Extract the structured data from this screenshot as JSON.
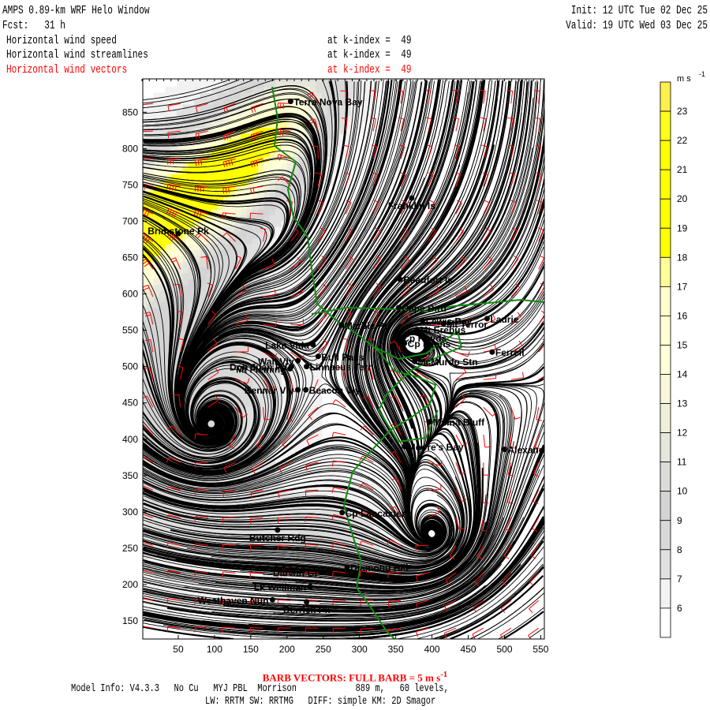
{
  "header": {
    "title": "AMPS 0.89-km WRF Helo Window",
    "forecast": "Fcst:   31 h",
    "init": "Init: 12 UTC Tue 02 Dec 25",
    "valid": "Valid: 19 UTC Wed 03 Dec 25",
    "fields": [
      {
        "name": "Horizontal wind speed",
        "level": "at k-index =  49",
        "color": "#000000"
      },
      {
        "name": "Horizontal wind streamlines",
        "level": "at k-index =  49",
        "color": "#000000"
      },
      {
        "name": "Horizontal wind vectors",
        "level": "at k-index =  49",
        "color": "#ff0000"
      }
    ]
  },
  "axes": {
    "x_ticks": [
      "50",
      "100",
      "150",
      "200",
      "250",
      "300",
      "350",
      "400",
      "450",
      "500",
      "550"
    ],
    "y_ticks": [
      "150",
      "200",
      "250",
      "300",
      "350",
      "400",
      "450",
      "500",
      "550",
      "600",
      "650",
      "700",
      "750",
      "800",
      "850"
    ],
    "xlim": [
      0,
      555
    ],
    "ylim": [
      125,
      895
    ]
  },
  "colorbar": {
    "units": "m s",
    "units_exp": "-1",
    "labels": [
      "23",
      "22",
      "21",
      "20",
      "19",
      "18",
      "17",
      "16",
      "15",
      "14",
      "13",
      "12",
      "11",
      "10",
      "9",
      "8",
      "7",
      "6"
    ],
    "colors": [
      "#fff04a",
      "#ffff1a",
      "#ffff00",
      "#ffff00",
      "#ffff00",
      "#ffff00",
      "#ffff99",
      "#ffffcc",
      "#ffffd6",
      "#ffffd9",
      "#f8f8d8",
      "#f0f0da",
      "#e6e6dc",
      "#dcdcd8",
      "#d4d4d4",
      "#d8d8d8",
      "#e0e0e0",
      "#f2f2f2",
      "#ffffff"
    ]
  },
  "map": {
    "streamline_color": "#000000",
    "barb_color": "#ff0000",
    "coast_color": "#138a13",
    "places": [
      {
        "name": "Terra Nova Bay",
        "x": 205,
        "y": 865
      },
      {
        "name": "Franklin Is",
        "x": 372,
        "y": 732
      },
      {
        "name": "Brimstone Pk",
        "x": 50,
        "y": 683
      },
      {
        "name": "Beaufort Is",
        "x": 356,
        "y": 620
      },
      {
        "name": "Cape Bird",
        "x": 354,
        "y": 581
      },
      {
        "name": "Marble Pt",
        "x": 275,
        "y": 557
      },
      {
        "name": "Lewis Bay",
        "x": 387,
        "y": 563
      },
      {
        "name": "Mt Terror",
        "x": 416,
        "y": 559
      },
      {
        "name": "Laurie",
        "x": 476,
        "y": 566
      },
      {
        "name": "Mt Erebus",
        "x": 379,
        "y": 551
      },
      {
        "name": "Cp Royds",
        "x": 355,
        "y": 540
      },
      {
        "name": "Cp Evans",
        "x": 362,
        "y": 532
      },
      {
        "name": "Ferrell",
        "x": 483,
        "y": 520
      },
      {
        "name": "McMurdo Stn",
        "x": 376,
        "y": 507
      },
      {
        "name": "Lake Vida",
        "x": 236,
        "y": 530
      },
      {
        "name": "Bull Pass",
        "x": 243,
        "y": 514
      },
      {
        "name": "Wall Vly",
        "x": 215,
        "y": 508
      },
      {
        "name": "Don Juan Pd",
        "x": 206,
        "y": 500
      },
      {
        "name": "Linnaeus Terr",
        "x": 227,
        "y": 500
      },
      {
        "name": "Mt Fleming",
        "x": 204,
        "y": 497
      },
      {
        "name": "Kennar Vly",
        "x": 215,
        "y": 468
      },
      {
        "name": "Beacon Vly",
        "x": 226,
        "y": 468
      },
      {
        "name": "Minna Bluff",
        "x": 397,
        "y": 424
      },
      {
        "name": "Moore's Bay",
        "x": 362,
        "y": 390
      },
      {
        "name": "Alexander",
        "x": 500,
        "y": 386
      },
      {
        "name": "Cp Lancaster",
        "x": 276,
        "y": 299
      },
      {
        "name": "Butcher Rdg",
        "x": 187,
        "y": 275
      },
      {
        "name": "Darwin Gl",
        "x": 247,
        "y": 217
      },
      {
        "name": "Diamond Hill",
        "x": 283,
        "y": 224
      },
      {
        "name": "Lk Wellman",
        "x": 232,
        "y": 197
      },
      {
        "name": "Westhaven Nun",
        "x": 180,
        "y": 179
      },
      {
        "name": "Derrick Pk",
        "x": 227,
        "y": 176
      }
    ]
  },
  "footer": {
    "barb_note": "BARB VECTORS:  FULL BARB = 5 m s",
    "barb_exp": "-1",
    "model_info": "Model Info: V4.3.3   No Cu   MYJ PBL  Morrison            889 m,   60 levels,",
    "physics": "LW: RRTM SW: RRTMG   DIFF: simple KM: 2D Smagor"
  }
}
